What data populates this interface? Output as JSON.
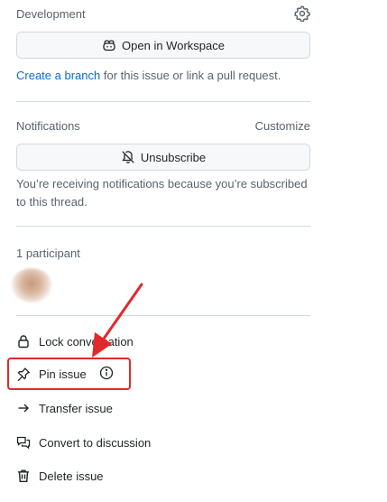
{
  "development": {
    "title": "Development",
    "open_workspace_label": "Open in Workspace",
    "create_branch_link": "Create a branch",
    "note_rest": " for this issue or link a pull request."
  },
  "notifications": {
    "title": "Notifications",
    "customize_label": "Customize",
    "unsubscribe_label": "Unsubscribe",
    "note": "You’re receiving notifications because you’re subscribed to this thread."
  },
  "participants": {
    "title": "1 participant"
  },
  "actions": [
    {
      "label": "Lock conversation",
      "icon": "lock-icon"
    },
    {
      "label": "Pin issue",
      "icon": "pin-icon"
    },
    {
      "label": "Transfer issue",
      "icon": "arrow-right-icon"
    },
    {
      "label": "Convert to discussion",
      "icon": "comment-discussion-icon"
    },
    {
      "label": "Delete issue",
      "icon": "trash-icon"
    }
  ],
  "annotation": {
    "color": "#e3282b"
  }
}
